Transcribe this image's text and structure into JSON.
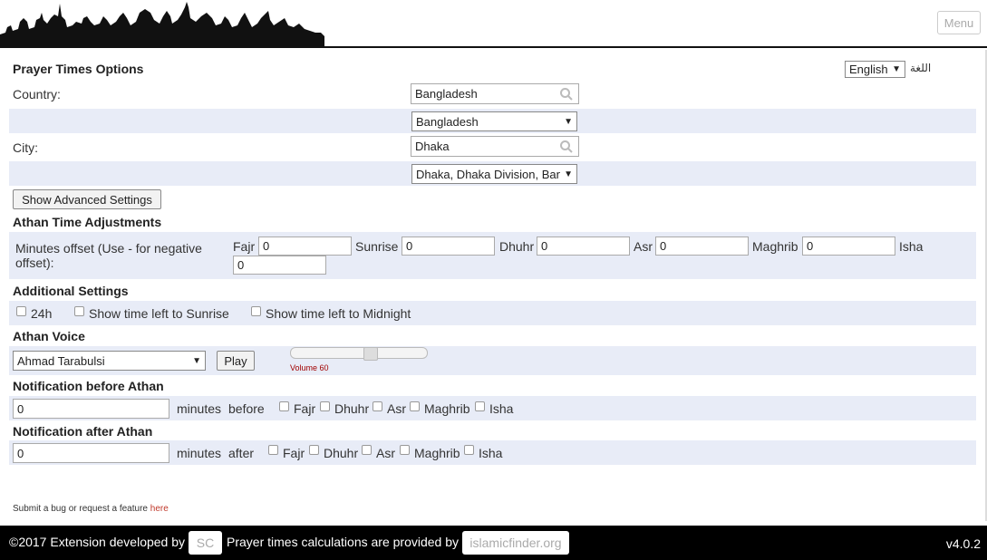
{
  "header": {
    "menu_label": "Menu"
  },
  "options": {
    "title": "Prayer Times Options",
    "language_value": "English",
    "language_label": "اللغة",
    "country_label": "Country:",
    "country_search": "Bangladesh",
    "country_select": "Bangladesh",
    "city_label": "City:",
    "city_search": "Dhaka",
    "city_select": "Dhaka, Dhaka Division, Bangladesh"
  },
  "advanced_button": "Show Advanced Settings",
  "adjustments": {
    "title": "Athan Time Adjustments",
    "offset_label": "Minutes offset (Use - for negative offset):",
    "fields": [
      {
        "label": "Fajr",
        "value": "0"
      },
      {
        "label": "Sunrise",
        "value": "0"
      },
      {
        "label": "Dhuhr",
        "value": "0"
      },
      {
        "label": "Asr",
        "value": "0"
      },
      {
        "label": "Maghrib",
        "value": "0"
      },
      {
        "label": "Isha",
        "value": "0"
      }
    ]
  },
  "additional": {
    "title": "Additional Settings",
    "options": [
      "24h",
      "Show time left to Sunrise",
      "Show time left to Midnight"
    ]
  },
  "voice": {
    "title": "Athan Voice",
    "selected": "Ahmad Tarabulsi",
    "play_label": "Play",
    "volume_label": "Volume 60",
    "volume_value": 60
  },
  "notify_before": {
    "title": "Notification before Athan",
    "value": "0",
    "minutes_label": "minutes",
    "when_label": "before",
    "prayers": [
      "Fajr",
      "Dhuhr",
      "Asr",
      "Maghrib",
      "Isha"
    ]
  },
  "notify_after": {
    "title": "Notification after Athan",
    "value": "0",
    "minutes_label": "minutes",
    "when_label": "after",
    "prayers": [
      "Fajr",
      "Dhuhr",
      "Asr",
      "Maghrib",
      "Isha"
    ]
  },
  "bug_text": "Submit a bug or request a feature",
  "bug_link": "here",
  "footer": {
    "copyright": "©2017 Extension developed by",
    "dev_badge": "SC",
    "provider_text": "Prayer times calculations are provided by",
    "provider_badge": "islamicfinder.org",
    "version": "v4.0.2"
  },
  "colors": {
    "band": "#e8ecf7",
    "footer_bg": "#000000",
    "link": "#c0392b",
    "volume_label": "#a00000"
  }
}
